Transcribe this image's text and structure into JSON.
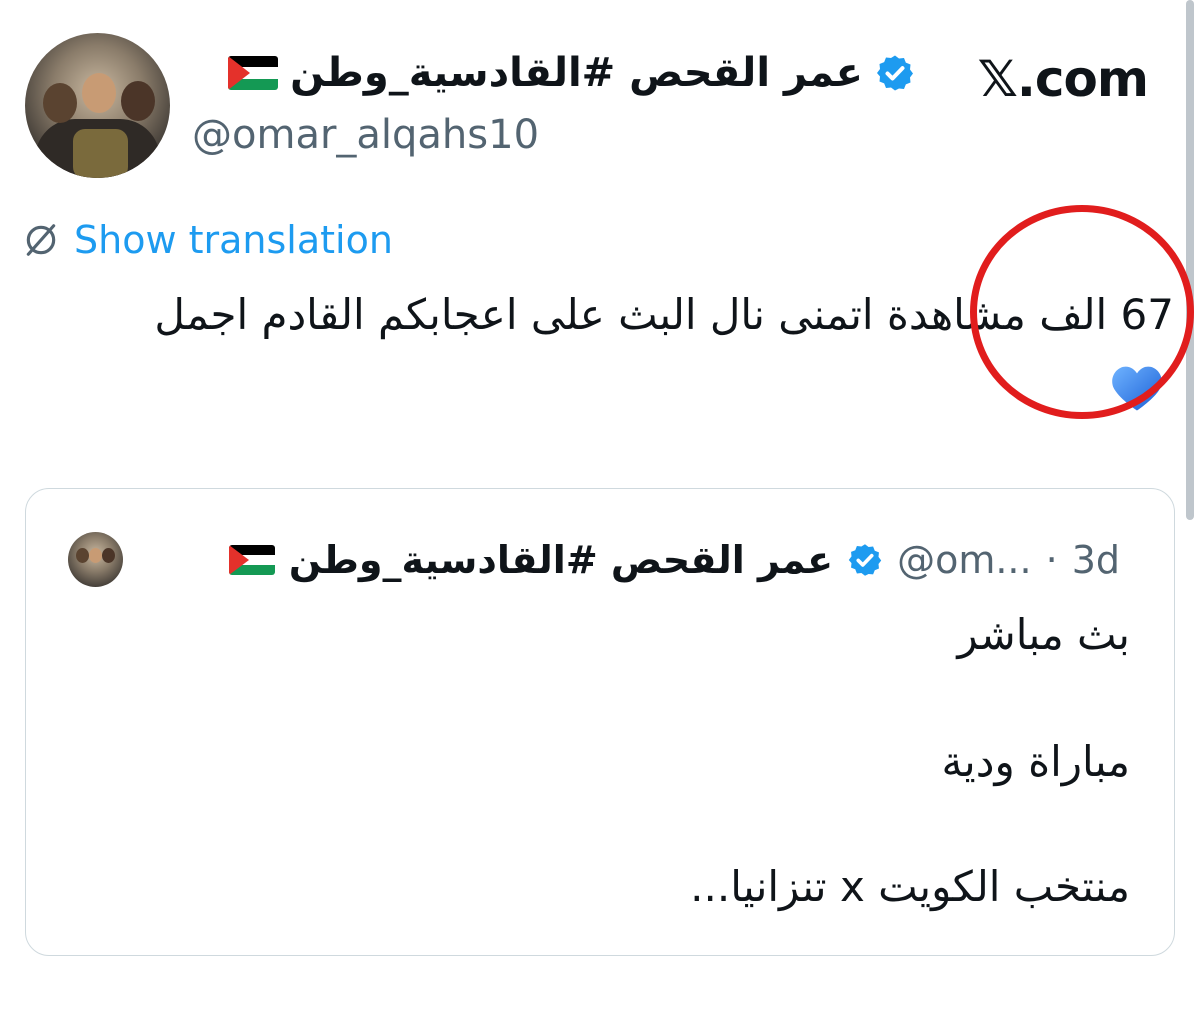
{
  "site": "𝕏.com",
  "author": {
    "display_name": "عمر القحص #القادسية_وطن",
    "handle": "@omar_alqahs10",
    "flag": "palestine-flag",
    "verified_icon": "verified-badge-icon"
  },
  "translate": {
    "label": "Show translation",
    "icon": "translate-globe-icon"
  },
  "tweet": {
    "text": "67 الف مشاهدة اتمنى نال البث على اعجابكم القادم اجمل",
    "emoji": "blue-heart-icon"
  },
  "quote": {
    "display_name": "عمر القحص #القادسية_وطن",
    "handle": "@om...",
    "separator": "·",
    "time": "3d",
    "lines": [
      "بث مباشر",
      "مباراة ودية",
      "منتخب الكويت x تنزانيا..."
    ]
  },
  "colors": {
    "accent": "#1d9bf0",
    "annotation": "#e11d1d",
    "muted": "#536471"
  }
}
